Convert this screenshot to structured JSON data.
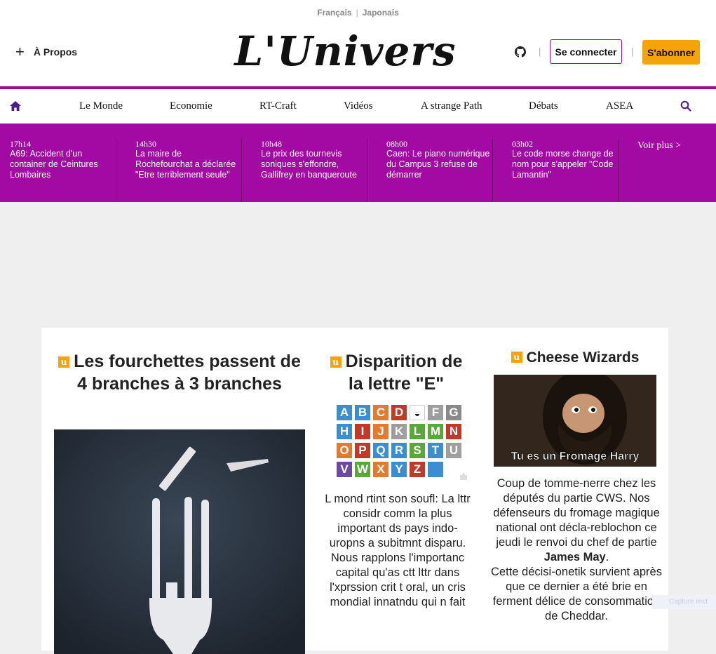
{
  "header": {
    "languages": [
      "Français",
      "Japonais"
    ],
    "about_label": "À Propos",
    "logo_text": "L'Univers",
    "login_label": "Se connecter",
    "subscribe_label": "S'abonner"
  },
  "nav": {
    "items": [
      "Le Monde",
      "Economie",
      "RT-Craft",
      "Vidéos",
      "A strange Path",
      "Débats",
      "ASEA"
    ]
  },
  "ticker": {
    "items": [
      {
        "time": "17h14",
        "text": "A69: Accident d'un container de Ceintures Lombaires"
      },
      {
        "time": "14h30",
        "text": "La maire de Rochefourchat a déclarée \"Etre terriblement seule\""
      },
      {
        "time": "10h48",
        "text": "Le prix des tournevis soniques s'effondre, Gallifrey en banqueroute"
      },
      {
        "time": "08h00",
        "text": "Caen: Le piano numérique du Campus 3 refuse de démarrer"
      },
      {
        "time": "03h02",
        "text": "Le code morse change de nom pour s'appeler \"Code Lamantin\""
      }
    ],
    "more_label": "Voir plus >"
  },
  "articles": {
    "a1": {
      "title": "Les fourchettes passent de 4 branches à 3 branches"
    },
    "a2": {
      "title": "Disparition de la lettre \"E\"",
      "letters": [
        "A",
        "B",
        "C",
        "D",
        "F",
        "G",
        "H",
        "I",
        "J",
        "K",
        "L",
        "M",
        "N",
        "O",
        "P",
        "Q",
        "R",
        "S",
        "T",
        "U",
        "V",
        "W",
        "X",
        "Y",
        "Z"
      ],
      "body": "L mond rtint son soufl: La lttr considr comm la plus important ds pays indo-uropns a subitmnt disparu. Nous rapplons l'importanc capital qu'as ctt lttr dans l'xprssion crit t oral, un cris mondial innatndu qui n fait"
    },
    "a3": {
      "title": "Cheese Wizards",
      "image_caption": "Tu es un Fromage Harry",
      "body_1": "Coup de tomme-nerre chez les députés du partie CWS. Nos défenseurs du fromage magique national ont décla-reblochon ce jeudi le renvoi du chef de partie",
      "body_bold": "James May",
      "body_2": "Cette décisi-onetik survient après que ce dernier a été brie en ferment délice de consommation de Cheddar."
    }
  },
  "overlay": {
    "watermark": "Capture rect"
  },
  "colors": {
    "purple": "#9b0a9b",
    "ticker_bg": "#a30aa3",
    "orange": "#f5a30a"
  }
}
